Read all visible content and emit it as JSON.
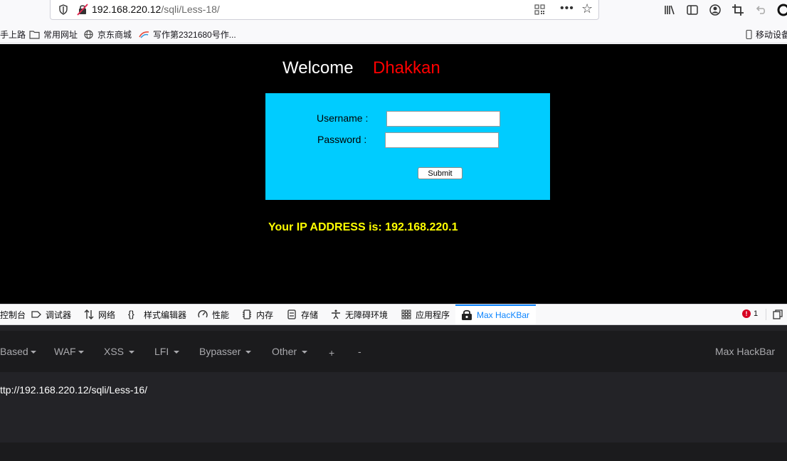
{
  "browser": {
    "url_host": "192.168.220.12",
    "url_path": "/sqli/Less-18/"
  },
  "bookmarks": [
    {
      "label": "手上路",
      "icon": "none"
    },
    {
      "label": "常用网址",
      "icon": "folder-icon"
    },
    {
      "label": "京东商城",
      "icon": "globe-icon"
    },
    {
      "label": "写作第2321680号作...",
      "icon": "site-icon"
    }
  ],
  "bookmarks_right": "移动设备",
  "page": {
    "welcome": "Welcome",
    "name": "Dhakkan",
    "username_label": "Username :",
    "password_label": "Password :",
    "submit_label": "Submit",
    "ip_text": "Your IP ADDRESS is: 192.168.220.1"
  },
  "devtools": {
    "tabs": [
      "控制台",
      "调试器",
      "网络",
      "样式编辑器",
      "性能",
      "内存",
      "存储",
      "无障碍环境",
      "应用程序",
      "Max HacKBar"
    ],
    "active_tab": "Max HacKBar",
    "error_count": "1"
  },
  "hackbar": {
    "menu": [
      "Based",
      "WAF",
      "XSS",
      "LFI",
      "Bypasser",
      "Other",
      "+",
      "-"
    ],
    "brand": "Max HackBar",
    "url_value": "ttp://192.168.220.12/sqli/Less-16/"
  },
  "colors": {
    "page_bg": "#000000",
    "login_bg": "#00ccff",
    "name_color": "#ff0000",
    "ip_color": "#ffff00",
    "active_tab": "#0a84ff"
  }
}
